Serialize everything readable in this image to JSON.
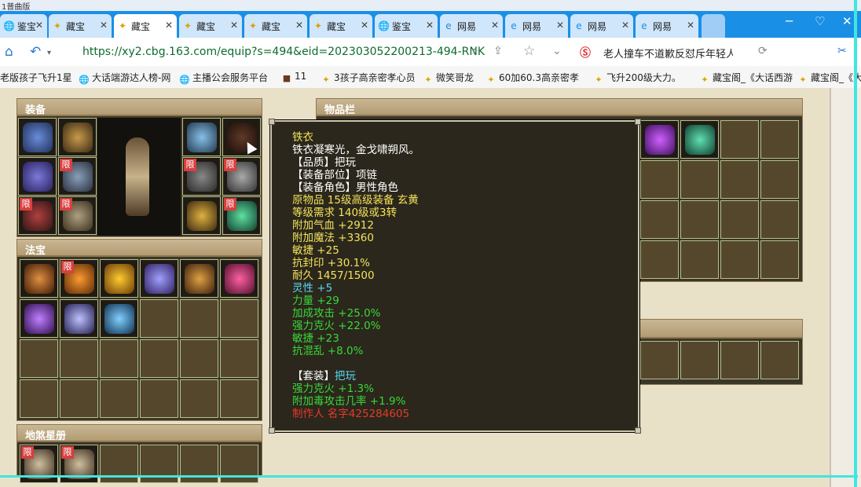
{
  "browser": {
    "top_strip": "1普曲版",
    "tabs": [
      {
        "label": "鉴宝",
        "icon": "globe-icon",
        "active": false
      },
      {
        "label": "藏宝",
        "icon": "gem-icon",
        "active": false
      },
      {
        "label": "藏宝",
        "icon": "gem-icon",
        "active": true
      },
      {
        "label": "藏宝",
        "icon": "gem-icon",
        "active": false
      },
      {
        "label": "藏宝",
        "icon": "gem-icon",
        "active": false
      },
      {
        "label": "藏宝",
        "icon": "gem-icon",
        "active": false
      },
      {
        "label": "鉴宝",
        "icon": "globe-icon",
        "active": false
      },
      {
        "label": "网易",
        "icon": "browser-e-icon",
        "active": false
      },
      {
        "label": "网易",
        "icon": "browser-e-icon",
        "active": false
      },
      {
        "label": "网易",
        "icon": "browser-e-icon",
        "active": false
      },
      {
        "label": "网易",
        "icon": "browser-e-icon",
        "active": false
      }
    ],
    "url": "https://xy2.cbg.163.com/equip?s=494&eid=202303052200213-494-RNK",
    "search_text": "老人撞车不道歉反怼斥年轻人",
    "bookmarks": [
      {
        "label": "老版孩子飞升1星",
        "icon": ""
      },
      {
        "label": "大话端游达人榜-网",
        "icon": "globe-icon"
      },
      {
        "label": "主播公会服务平台",
        "icon": "globe-icon"
      },
      {
        "label": "11",
        "icon": "game-icon"
      },
      {
        "label": "3孩子高亲密孝心员",
        "icon": "gem-icon"
      },
      {
        "label": "微笑哥龙",
        "icon": "gem-icon"
      },
      {
        "label": "60加60.3高亲密孝",
        "icon": "gem-icon"
      },
      {
        "label": "飞升200级大力。",
        "icon": "gem-icon"
      },
      {
        "label": "藏宝阁_《大话西游",
        "icon": "gem-icon"
      },
      {
        "label": "藏宝阁_《大",
        "icon": "gem-icon"
      }
    ]
  },
  "sections": {
    "equipment": "装备",
    "fabao": "法宝",
    "disha": "地煞星册",
    "inventory": "物品栏"
  },
  "limit_badge": "限",
  "tooltip": {
    "lines": [
      {
        "text": "铁衣",
        "color": "yellow"
      },
      {
        "text": "铁衣凝寒光，金戈啸朔风。",
        "color": "white"
      },
      {
        "text": "【品质】把玩",
        "color": "white"
      },
      {
        "text": "【装备部位】项链",
        "color": "white"
      },
      {
        "text": "【装备角色】男性角色",
        "color": "white"
      },
      {
        "text": "原物品 15级高级装备 玄黄",
        "color": "yellow"
      },
      {
        "text": "等级需求 140级或3转",
        "color": "yellow"
      },
      {
        "text": "附加气血 +2912",
        "color": "yellow"
      },
      {
        "text": "附加魔法 +3360",
        "color": "yellow"
      },
      {
        "text": "敏捷 +25",
        "color": "yellow"
      },
      {
        "text": "抗封印 +30.1%",
        "color": "yellow"
      },
      {
        "text": "耐久 1457/1500",
        "color": "yellow"
      },
      {
        "text": "灵性 +5",
        "color": "cyan"
      },
      {
        "text": "力量 +29",
        "color": "green"
      },
      {
        "text": "加成攻击 +25.0%",
        "color": "green"
      },
      {
        "text": "强力克火 +22.0%",
        "color": "green"
      },
      {
        "text": "敏捷 +23",
        "color": "green"
      },
      {
        "text": "抗混乱 +8.0%",
        "color": "green"
      },
      {
        "text": "",
        "color": "white"
      },
      {
        "text": "【套装】",
        "color": "white",
        "suffix": "把玩",
        "suffix_color": "cyan"
      },
      {
        "text": "强力克火 +1.3%",
        "color": "green"
      },
      {
        "text": "附加毒攻击几率 +1.9%",
        "color": "green"
      },
      {
        "text": "制作人 名字425284605",
        "color": "red"
      }
    ]
  }
}
